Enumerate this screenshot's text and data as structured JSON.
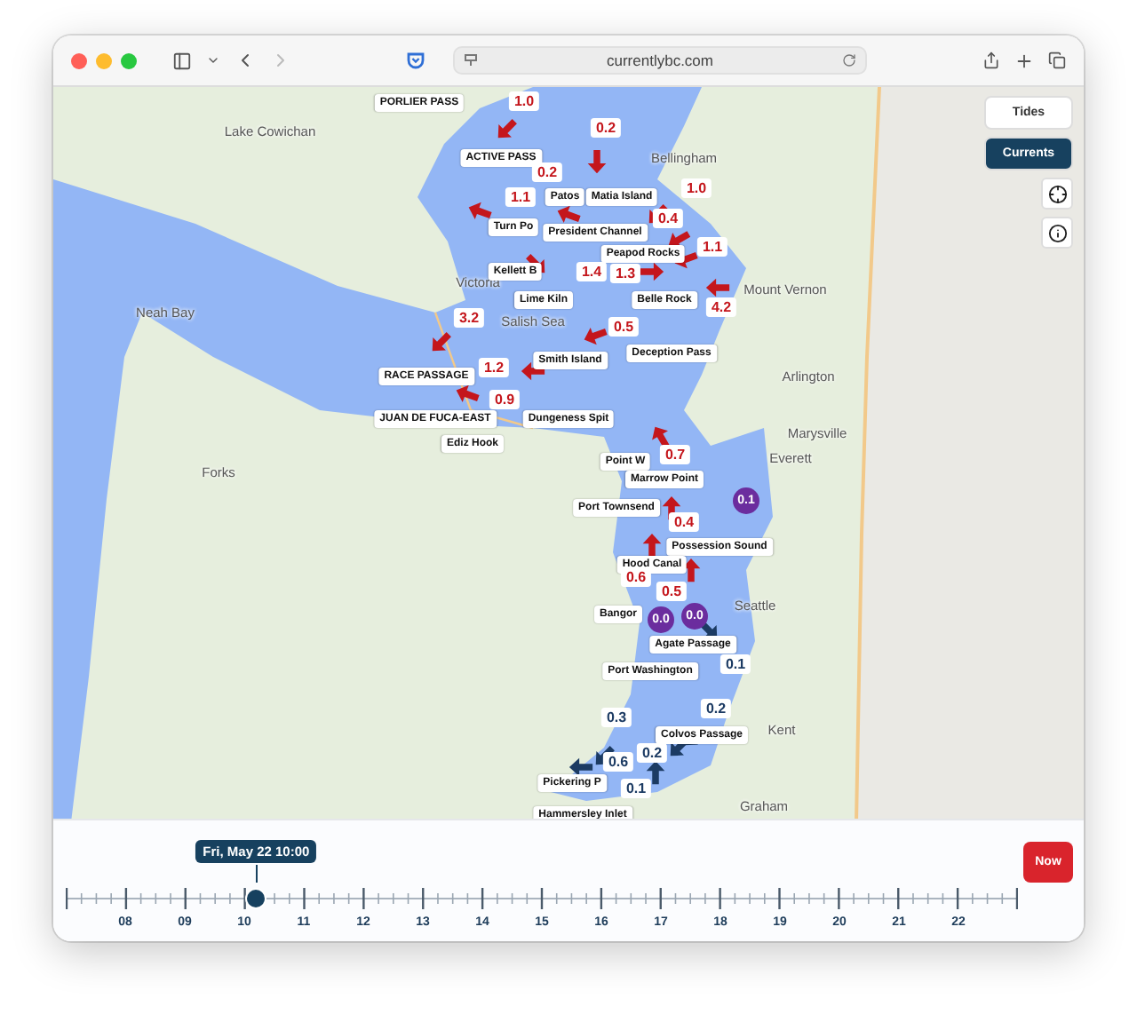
{
  "browser": {
    "url": "currentlybc.com"
  },
  "mode_buttons": [
    {
      "label": "Tides",
      "selected": false
    },
    {
      "label": "Currents",
      "selected": true
    }
  ],
  "place_labels": [
    "Lake Cowichan",
    "Bellingham",
    "Victoria",
    "Mount Vernon",
    "Salish Sea",
    "Neah Bay",
    "Arlington",
    "Marysville",
    "Forks",
    "Everett",
    "Seattle",
    "Kent",
    "Graham"
  ],
  "stations": [
    "PORLIER PASS",
    "ACTIVE PASS",
    "Patos",
    "Matia Island",
    "Turn Po",
    "President Channel",
    "Peapod Rocks",
    "Kellett B",
    "Lime Kiln",
    "Belle Rock",
    "Smith Island",
    "Deception Pass",
    "RACE PASSAGE",
    "JUAN DE FUCA-EAST",
    "Dungeness Spit",
    "Ediz Hook",
    "Point W",
    "Marrow Point",
    "Port Townsend",
    "Possession Sound",
    "Hood Canal",
    "Bangor",
    "Agate Passage",
    "Port Washington",
    "Colvos Passage",
    "Pickering P",
    "Hammersley Inlet"
  ],
  "currents": [
    {
      "value": "1.0",
      "kind": "arrow",
      "color": "#c4161c"
    },
    {
      "value": "0.2",
      "kind": "arrow",
      "color": "#c4161c"
    },
    {
      "value": "0.2",
      "kind": "arrow",
      "color": "#c4161c"
    },
    {
      "value": "1.0",
      "kind": "arrow",
      "color": "#c4161c"
    },
    {
      "value": "1.1",
      "kind": "arrow",
      "color": "#c4161c"
    },
    {
      "value": "0.4",
      "kind": "arrow",
      "color": "#c4161c"
    },
    {
      "value": "1.1",
      "kind": "arrow",
      "color": "#c4161c"
    },
    {
      "value": "1.4",
      "kind": "arrow",
      "color": "#c4161c"
    },
    {
      "value": "1.3",
      "kind": "arrow",
      "color": "#c4161c"
    },
    {
      "value": "4.2",
      "kind": "arrow",
      "color": "#c4161c"
    },
    {
      "value": "0.5",
      "kind": "arrow",
      "color": "#c4161c"
    },
    {
      "value": "3.2",
      "kind": "arrow",
      "color": "#c4161c"
    },
    {
      "value": "1.2",
      "kind": "arrow",
      "color": "#c4161c"
    },
    {
      "value": "0.9",
      "kind": "arrow",
      "color": "#c4161c"
    },
    {
      "value": "0.7",
      "kind": "arrow",
      "color": "#c4161c"
    },
    {
      "value": "0.4",
      "kind": "arrow",
      "color": "#c4161c"
    },
    {
      "value": "0.6",
      "kind": "arrow",
      "color": "#c4161c"
    },
    {
      "value": "0.5",
      "kind": "arrow",
      "color": "#c4161c"
    },
    {
      "value": "0.1",
      "kind": "arrow",
      "color": "#1c3b63"
    },
    {
      "value": "0.2",
      "kind": "arrow",
      "color": "#1c3b63"
    },
    {
      "value": "0.3",
      "kind": "arrow",
      "color": "#1c3b63"
    },
    {
      "value": "0.6",
      "kind": "arrow",
      "color": "#1c3b63"
    },
    {
      "value": "0.2",
      "kind": "arrow",
      "color": "#1c3b63"
    },
    {
      "value": "0.1",
      "kind": "arrow",
      "color": "#1c3b63"
    },
    {
      "value": "0.1",
      "kind": "circle",
      "color": "#6b2d9e"
    },
    {
      "value": "0.0",
      "kind": "circle",
      "color": "#6b2d9e"
    },
    {
      "value": "0.0",
      "kind": "circle",
      "color": "#6b2d9e"
    }
  ],
  "timeline": {
    "time_label": "Fri, May 22 10:00",
    "level": 0.2,
    "hours": [
      "08",
      "09",
      "10",
      "11",
      "12",
      "13",
      "14",
      "15",
      "16",
      "17",
      "18",
      "19",
      "20",
      "21",
      "22"
    ],
    "now_button": "Now"
  }
}
